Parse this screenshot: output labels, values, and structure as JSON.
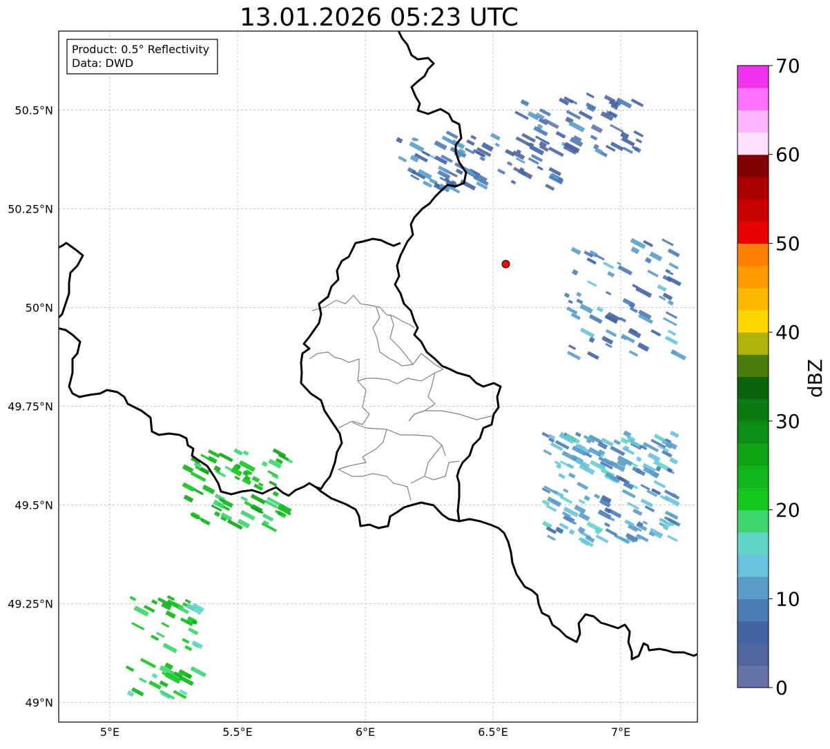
{
  "title": "13.01.2026 05:23 UTC",
  "info_box": {
    "product": "Product: 0.5° Reflectivity",
    "data": "Data: DWD"
  },
  "axes": {
    "lon_ticks": [
      {
        "value": 5.0,
        "label": "5°E"
      },
      {
        "value": 5.5,
        "label": "5.5°E"
      },
      {
        "value": 6.0,
        "label": "6°E"
      },
      {
        "value": 6.5,
        "label": "6.5°E"
      },
      {
        "value": 7.0,
        "label": "7°E"
      }
    ],
    "lat_ticks": [
      {
        "value": 50.5,
        "label": "50.5°N"
      },
      {
        "value": 50.25,
        "label": "50.25°N"
      },
      {
        "value": 50.0,
        "label": "50°N"
      },
      {
        "value": 49.75,
        "label": "49.75°N"
      },
      {
        "value": 49.5,
        "label": "49.5°N"
      },
      {
        "value": 49.25,
        "label": "49.25°N"
      },
      {
        "value": 49.0,
        "label": "49°N"
      }
    ],
    "lon_range": [
      4.8,
      7.3
    ],
    "lat_range": [
      48.95,
      50.7
    ],
    "grid": true
  },
  "radar_site": {
    "lon": 6.55,
    "lat": 50.11,
    "color": "#ff0000"
  },
  "colorbar": {
    "label": "dBZ",
    "range": [
      0,
      70
    ],
    "step": 2.5,
    "ticks": [
      {
        "value": 0,
        "label": "0"
      },
      {
        "value": 10,
        "label": "10"
      },
      {
        "value": 20,
        "label": "20"
      },
      {
        "value": 30,
        "label": "30"
      },
      {
        "value": 40,
        "label": "40"
      },
      {
        "value": 50,
        "label": "50"
      },
      {
        "value": 60,
        "label": "60"
      },
      {
        "value": 70,
        "label": "70"
      }
    ],
    "colors": [
      "#6473a8",
      "#51669e",
      "#4263a4",
      "#4a7bb5",
      "#5a9dc9",
      "#68c2dd",
      "#60d5c5",
      "#3cd56e",
      "#12c61c",
      "#10b518",
      "#10a316",
      "#0d8d13",
      "#0b7a10",
      "#0a620c",
      "#4b7e0d",
      "#afb20b",
      "#ffd700",
      "#ffb700",
      "#ff9b00",
      "#ff7f00",
      "#e60000",
      "#c70000",
      "#a90000",
      "#800000",
      "#ffe0ff",
      "#ffb4ff",
      "#ff70ff",
      "#ee33ee"
    ]
  },
  "map_layers": [
    "national-borders",
    "luxembourg-districts",
    "precipitation-echoes"
  ],
  "echo_regions": [
    {
      "name": "north-cells-west",
      "lon": 6.28,
      "lat": 50.38,
      "dbz": 6
    },
    {
      "name": "north-cells-center",
      "lon": 6.52,
      "lat": 50.38,
      "dbz": 5
    },
    {
      "name": "northeast-band",
      "lon": 6.82,
      "lat": 50.47,
      "dbz": 4
    },
    {
      "name": "east-band",
      "lon": 7.0,
      "lat": 50.03,
      "dbz": 7
    },
    {
      "name": "southeast-cluster",
      "lon": 6.95,
      "lat": 49.55,
      "dbz": 9
    },
    {
      "name": "border-cells",
      "lon": 5.48,
      "lat": 49.55,
      "dbz": 20
    },
    {
      "name": "southwest-cells",
      "lon": 5.2,
      "lat": 49.15,
      "dbz": 18
    }
  ]
}
